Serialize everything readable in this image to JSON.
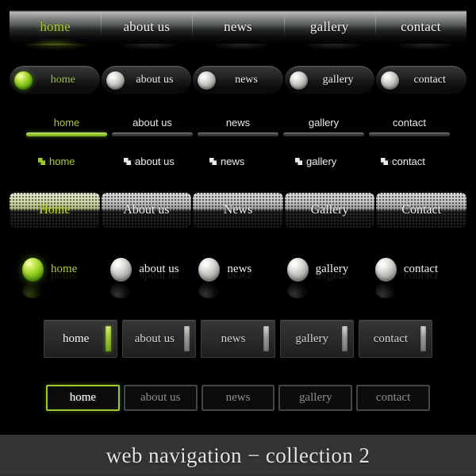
{
  "footer": {
    "title": "web navigation − collection 2"
  },
  "accent": {
    "green": "#a9c83e",
    "green_bright": "#9ec830",
    "white": "#efefec",
    "gray_text": "#8f8f8c",
    "bar_gray": "#9a9a96",
    "footer_bg": "#343434",
    "page_bg": "#000000"
  },
  "navs": [
    {
      "id": "nav-glossy-bar",
      "style": "glossy-divider-bar",
      "active_index": 0,
      "items": [
        {
          "label": "home"
        },
        {
          "label": "about us"
        },
        {
          "label": "news"
        },
        {
          "label": "gallery"
        },
        {
          "label": "contact"
        }
      ]
    },
    {
      "id": "nav-pill-orb",
      "style": "pill-with-orb",
      "active_index": 0,
      "items": [
        {
          "label": "home",
          "orb": "orb-green-icon"
        },
        {
          "label": "about us",
          "orb": "orb-white-icon"
        },
        {
          "label": "news",
          "orb": "orb-white-icon"
        },
        {
          "label": "gallery",
          "orb": "orb-white-icon"
        },
        {
          "label": "contact",
          "orb": "orb-white-icon"
        }
      ]
    },
    {
      "id": "nav-underline",
      "style": "underline-tabs",
      "active_index": 0,
      "items": [
        {
          "label": "home"
        },
        {
          "label": "about us"
        },
        {
          "label": "news"
        },
        {
          "label": "gallery"
        },
        {
          "label": "contact"
        }
      ]
    },
    {
      "id": "nav-square-bullet",
      "style": "square-bullet-list",
      "active_index": 0,
      "items": [
        {
          "label": "home",
          "bullet": "square-notch-icon"
        },
        {
          "label": "about us",
          "bullet": "square-notch-icon"
        },
        {
          "label": "news",
          "bullet": "square-notch-icon"
        },
        {
          "label": "gallery",
          "bullet": "square-notch-icon"
        },
        {
          "label": "contact",
          "bullet": "square-notch-icon"
        }
      ]
    },
    {
      "id": "nav-halftone-tabs",
      "style": "halftone-dot-tabs",
      "active_index": 0,
      "items": [
        {
          "label": "Home"
        },
        {
          "label": "About us"
        },
        {
          "label": "News"
        },
        {
          "label": "Gallery"
        },
        {
          "label": "Contact"
        }
      ]
    },
    {
      "id": "nav-orb-list",
      "style": "orb-with-reflection",
      "active_index": 0,
      "items": [
        {
          "label": "home",
          "orb": "orb-green-icon"
        },
        {
          "label": "about us",
          "orb": "orb-white-icon"
        },
        {
          "label": "news",
          "orb": "orb-white-icon"
        },
        {
          "label": "gallery",
          "orb": "orb-white-icon"
        },
        {
          "label": "contact",
          "orb": "orb-white-icon"
        }
      ]
    },
    {
      "id": "nav-box-accent",
      "style": "box-with-accent-bar",
      "active_index": 0,
      "items": [
        {
          "label": "home",
          "accent": "accent-bar-green"
        },
        {
          "label": "about us",
          "accent": "accent-bar-gray"
        },
        {
          "label": "news",
          "accent": "accent-bar-gray"
        },
        {
          "label": "gallery",
          "accent": "accent-bar-gray"
        },
        {
          "label": "contact",
          "accent": "accent-bar-gray"
        }
      ]
    },
    {
      "id": "nav-outline-box",
      "style": "outlined-boxes",
      "active_index": 0,
      "items": [
        {
          "label": "home"
        },
        {
          "label": "about us"
        },
        {
          "label": "news"
        },
        {
          "label": "gallery"
        },
        {
          "label": "contact"
        }
      ]
    }
  ]
}
